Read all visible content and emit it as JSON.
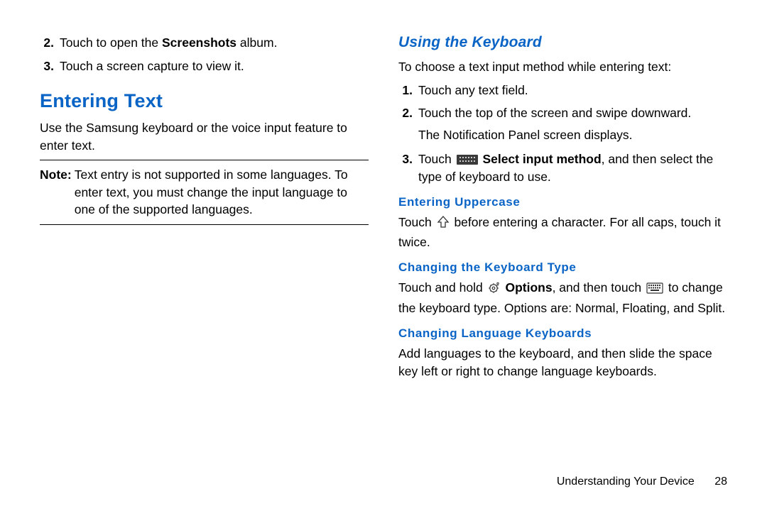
{
  "left": {
    "list": [
      {
        "num": "2.",
        "pre": "Touch to open the ",
        "bold": "Screenshots",
        "post": " album."
      },
      {
        "num": "3.",
        "pre": "Touch a screen capture to view it.",
        "bold": "",
        "post": ""
      }
    ],
    "h1": "Entering Text",
    "intro": "Use the Samsung keyboard or the voice input feature to enter text.",
    "note_label": "Note:",
    "note_body": "Text entry is not supported in some languages. To enter text, you must change the input language to one of the supported languages."
  },
  "right": {
    "h2": "Using the Keyboard",
    "intro": "To choose a text input method while entering text:",
    "steps": [
      {
        "num": "1.",
        "text": "Touch any text field."
      },
      {
        "num": "2.",
        "line1": "Touch the top of the screen and swipe downward.",
        "line2": "The Notification Panel screen displays."
      }
    ],
    "step3": {
      "num": "3.",
      "pre": " Touch ",
      "bold": "Select input method",
      "post": ", and then select the type of keyboard to use."
    },
    "upper": {
      "h": "Entering Uppercase",
      "pre": "Touch ",
      "post": " before entering a character. For all caps, touch it twice."
    },
    "ctype": {
      "h": "Changing the Keyboard Type",
      "pre": "Touch and hold ",
      "bold": "Options",
      "mid": ", and then touch ",
      "post": " to change the keyboard type. Options are: Normal, Floating, and Split."
    },
    "lang": {
      "h": "Changing Language Keyboards",
      "body": "Add languages to the keyboard, and then slide the space key left or right to change language keyboards."
    }
  },
  "footer": {
    "chapter": "Understanding Your Device",
    "page": "28"
  }
}
